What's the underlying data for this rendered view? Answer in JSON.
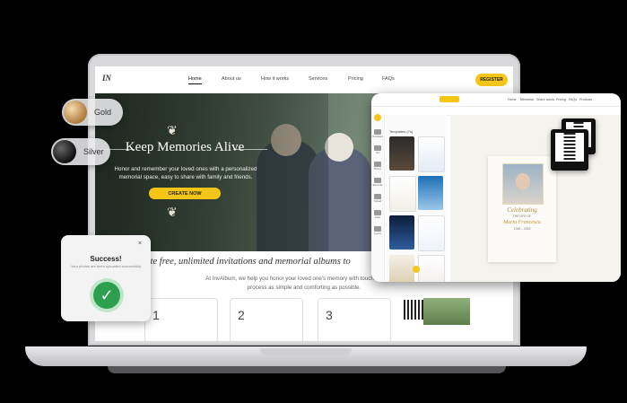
{
  "nav": {
    "logo": "IN",
    "links": [
      "Home",
      "About us",
      "How it works",
      "Services",
      "Pricing",
      "FAQs"
    ],
    "register": "REGISTER"
  },
  "hero": {
    "title": "Keep Memories Alive",
    "subtitle": "Honor and remember your loved ones with a personalized memorial space, easy to share with family and friends.",
    "cta": "CREATE NOW"
  },
  "lower": {
    "title": "reate free, unlimited invitations and memorial albums to",
    "subtitle": "At InvAlbum, we help you honor your loved one's memory with touch making the process as simple and comforting as possible.",
    "steps": [
      "1",
      "2",
      "3"
    ]
  },
  "badges": {
    "gold": "Gold",
    "silver": "Silver"
  },
  "toast": {
    "close": "×",
    "title": "Success!",
    "message": "Your photos are been uploaded successfully"
  },
  "editor": {
    "menu": [
      "Home",
      "Memorial",
      "Share words",
      "Pricing",
      "FAQs",
      "Products"
    ],
    "panel_title": "Templates (7s)",
    "tools": [
      "Templates",
      "Text",
      "Photos",
      "Elements",
      "Upload",
      "Draw",
      "Layers"
    ],
    "doc": {
      "celebrating": "Celebrating",
      "sub": "THE LIFE OF",
      "name": "Maria Francesca",
      "dates": "1946 – 2023"
    }
  },
  "colors": {
    "accent": "#f5c518",
    "success": "#2e9e4f",
    "hero": "#56685a"
  }
}
